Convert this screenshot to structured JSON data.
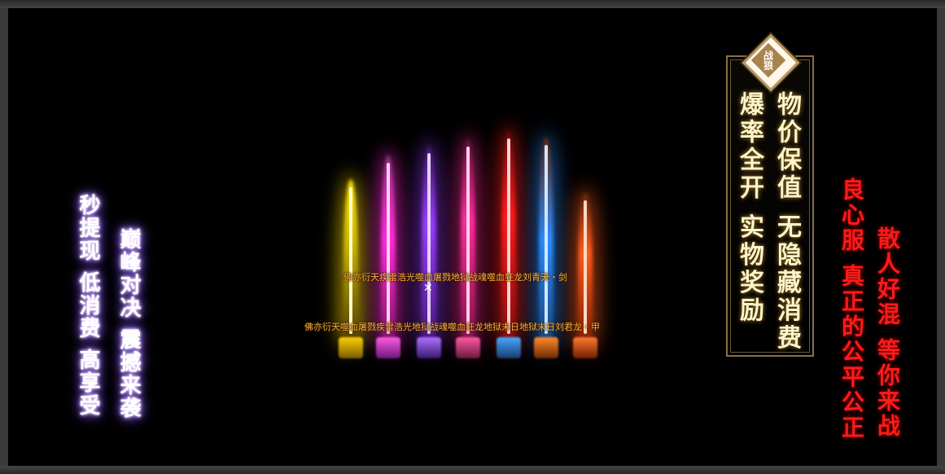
{
  "left_text": {
    "col1": "秒提现 低消费 高享受",
    "col2": "巅峰对决 震撼来袭"
  },
  "panel": {
    "badge": "战狼",
    "col1": "物价保值 无隐藏消费",
    "col2": "爆率全开 实物奖励"
  },
  "right_text": {
    "col1": "散人好混 等你来战",
    "col2": "良心服 真正的公平公正"
  },
  "items": {
    "weapons_label": "佛亦衍天疾雷浩光噬血屠戮地狱战魂噬血狂龙刘青天・剑",
    "armor_label": "佛亦衍天噬血屠戮疾雷浩光地狱战魂噬血狂龙地狱末日地狱末日刘君龙・甲"
  },
  "swords": [
    {
      "color": "#ffe600"
    },
    {
      "color": "#ff2bd6"
    },
    {
      "color": "#9a3cff"
    },
    {
      "color": "#ff2b9a"
    },
    {
      "color": "#ff1a1a"
    },
    {
      "color": "#2b8cff"
    },
    {
      "color": "#ff5a1a"
    }
  ]
}
